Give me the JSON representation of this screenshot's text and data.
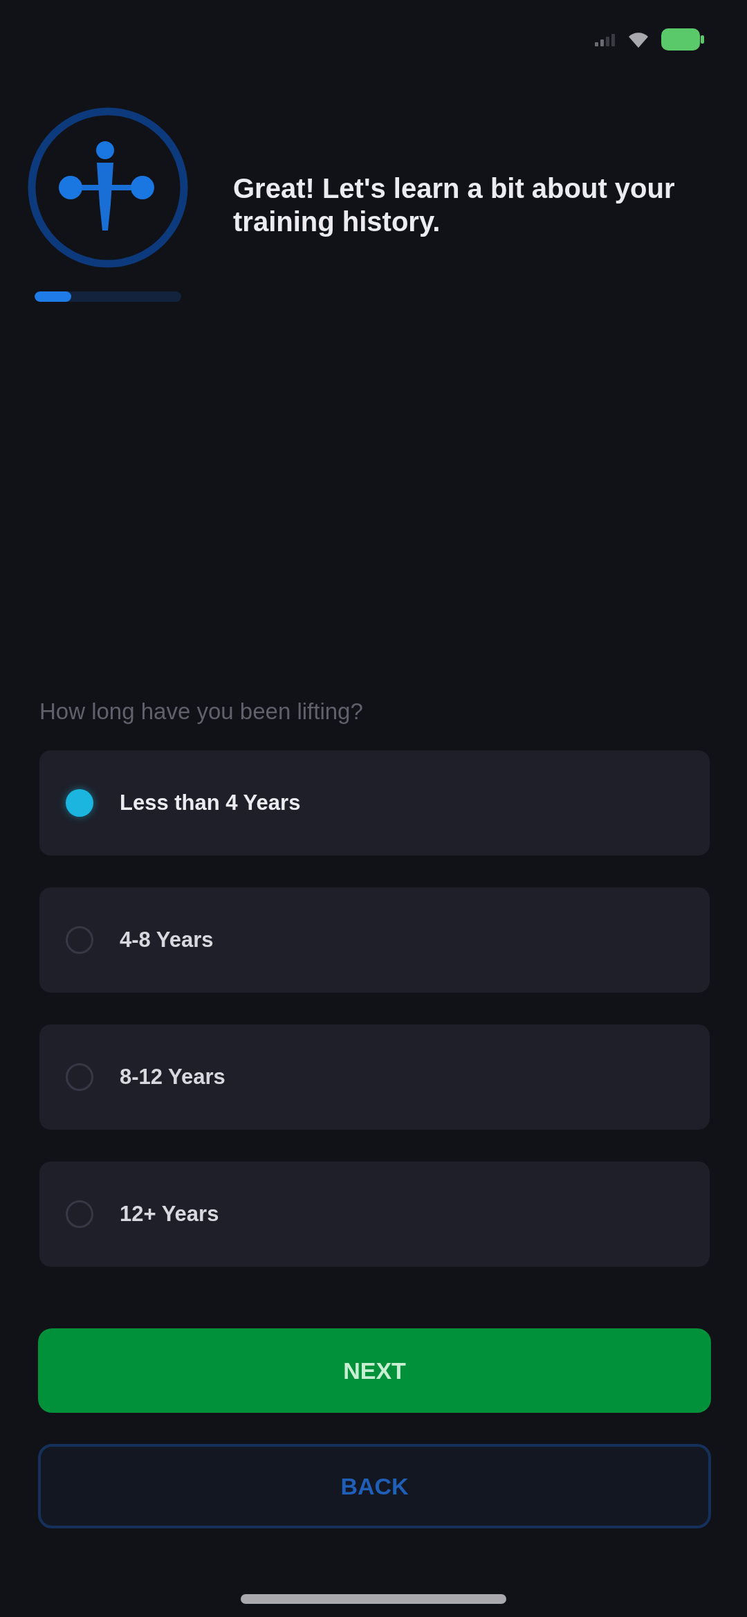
{
  "header": {
    "title": "Great! Let's learn a bit about your training history.",
    "progress": {
      "level": 0.25
    }
  },
  "question": {
    "label": "How long have you been lifting?",
    "options": [
      {
        "label": "Less than 4 Years",
        "selected": true
      },
      {
        "label": "4-8 Years",
        "selected": false
      },
      {
        "label": "8-12 Years",
        "selected": false
      },
      {
        "label": "12+ Years",
        "selected": false
      }
    ]
  },
  "buttons": [
    {
      "kind": "primary",
      "label": "NEXT"
    },
    {
      "kind": "secondary",
      "label": "BACK"
    }
  ]
}
